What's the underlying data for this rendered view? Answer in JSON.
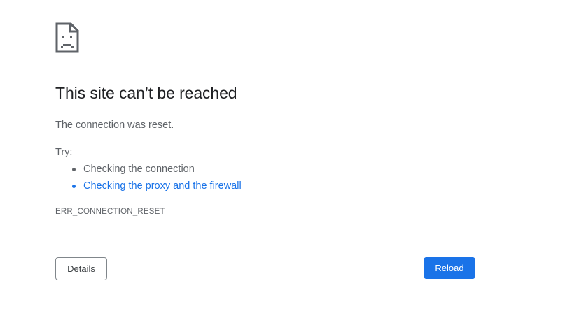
{
  "error_page": {
    "icon": "sad-page-icon",
    "title": "This site can’t be reached",
    "message": "The connection was reset.",
    "try_label": "Try:",
    "suggestions": [
      {
        "label": "Checking the connection",
        "is_link": false
      },
      {
        "label": "Checking the proxy and the firewall",
        "is_link": true
      }
    ],
    "error_code": "ERR_CONNECTION_RESET"
  },
  "buttons": {
    "details_label": "Details",
    "reload_label": "Reload"
  },
  "colors": {
    "link": "#1a73e8",
    "primary_button": "#1a73e8",
    "title_text": "#202124",
    "body_text": "#5f6368"
  }
}
